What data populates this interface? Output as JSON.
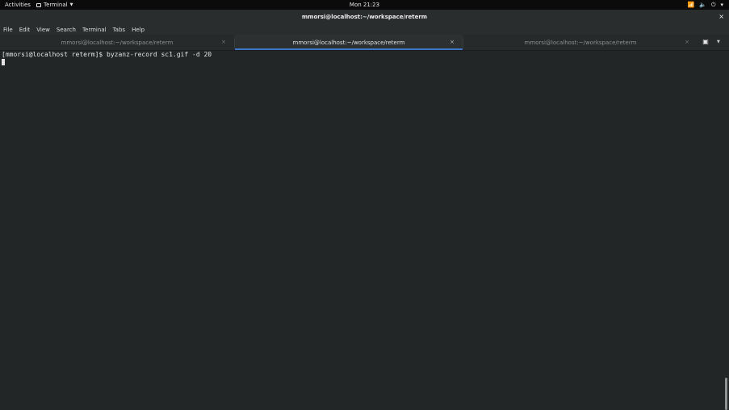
{
  "topbar": {
    "activities": "Activities",
    "app_name": "Terminal",
    "clock": "Mon 21:23"
  },
  "window": {
    "title": "mmorsi@localhost:~/workspace/reterm",
    "close": "×"
  },
  "menu": {
    "file": "File",
    "edit": "Edit",
    "view": "View",
    "search": "Search",
    "terminal": "Terminal",
    "tabs": "Tabs",
    "help": "Help"
  },
  "tabs": [
    {
      "label": "mmorsi@localhost:~/workspace/reterm",
      "active": false
    },
    {
      "label": "mmorsi@localhost:~/workspace/reterm",
      "active": true
    },
    {
      "label": "mmorsi@localhost:~/workspace/reterm",
      "active": false
    }
  ],
  "terminal": {
    "line1": "[mmorsi@localhost reterm]$ byzanz-record sc1.gif -d 20"
  },
  "colors": {
    "accent": "#3b77c4",
    "background": "#222627",
    "topbar": "#0b0b0b"
  },
  "icons": {
    "wifi": "wifi-icon",
    "volume": "volume-icon",
    "power": "power-icon",
    "new_tab": "new-tab-icon"
  }
}
